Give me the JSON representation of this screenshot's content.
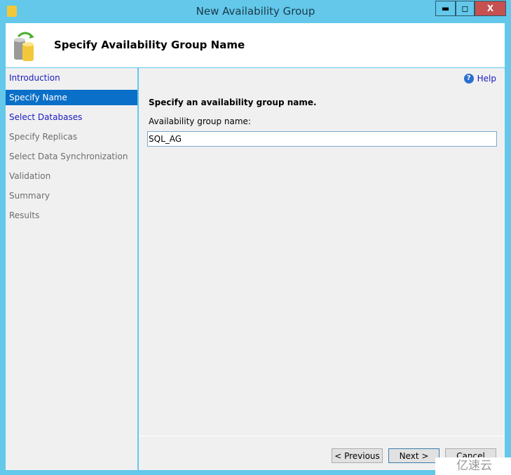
{
  "window": {
    "title": "New Availability Group",
    "minimize": "▬",
    "maximize": "◻",
    "close": "X"
  },
  "header": {
    "title": "Specify Availability Group Name"
  },
  "nav": {
    "items": [
      {
        "label": "Introduction",
        "state": "link"
      },
      {
        "label": "Specify Name",
        "state": "selected"
      },
      {
        "label": "Select Databases",
        "state": "link"
      },
      {
        "label": "Specify Replicas",
        "state": "disabled"
      },
      {
        "label": "Select Data Synchronization",
        "state": "disabled"
      },
      {
        "label": "Validation",
        "state": "disabled"
      },
      {
        "label": "Summary",
        "state": "disabled"
      },
      {
        "label": "Results",
        "state": "disabled"
      }
    ]
  },
  "main": {
    "help": "Help",
    "prompt": "Specify an availability group name.",
    "field_label": "Availability group name:",
    "field_value": "SQL_AG"
  },
  "buttons": {
    "previous": "< Previous",
    "next": "Next >",
    "cancel": "Cancel"
  },
  "watermark": "亿速云",
  "colors": {
    "titlebar": "#63c8ea",
    "selected": "#0a6fc8",
    "link": "#1a1ac0"
  }
}
